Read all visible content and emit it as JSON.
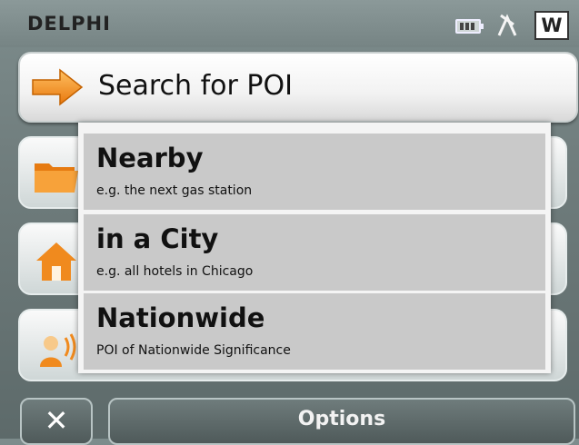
{
  "status_bar": {
    "brand": "DELPHI",
    "heading_indicator": "W",
    "icons": [
      "battery-icon",
      "gps-signal-icon"
    ]
  },
  "header": {
    "title": "Search for POI",
    "icon": "arrow-right-icon"
  },
  "background_buttons": [
    {
      "icon": "folder-icon"
    },
    {
      "icon": "home-icon"
    },
    {
      "icon": "contacts-icon"
    }
  ],
  "popup": {
    "options": [
      {
        "title": "Nearby",
        "subtitle": "e.g. the next gas station"
      },
      {
        "title": "in a City",
        "subtitle": "e.g. all hotels in Chicago"
      },
      {
        "title": "Nationwide",
        "subtitle": "POI of Nationwide Significance"
      }
    ]
  },
  "bottom_bar": {
    "close_symbol": "✕",
    "options_label": "Options"
  },
  "colors": {
    "accent_orange": "#f28a1a",
    "popup_item_bg": "#c9c9c9",
    "frame_bg": "#6f7c7c"
  }
}
